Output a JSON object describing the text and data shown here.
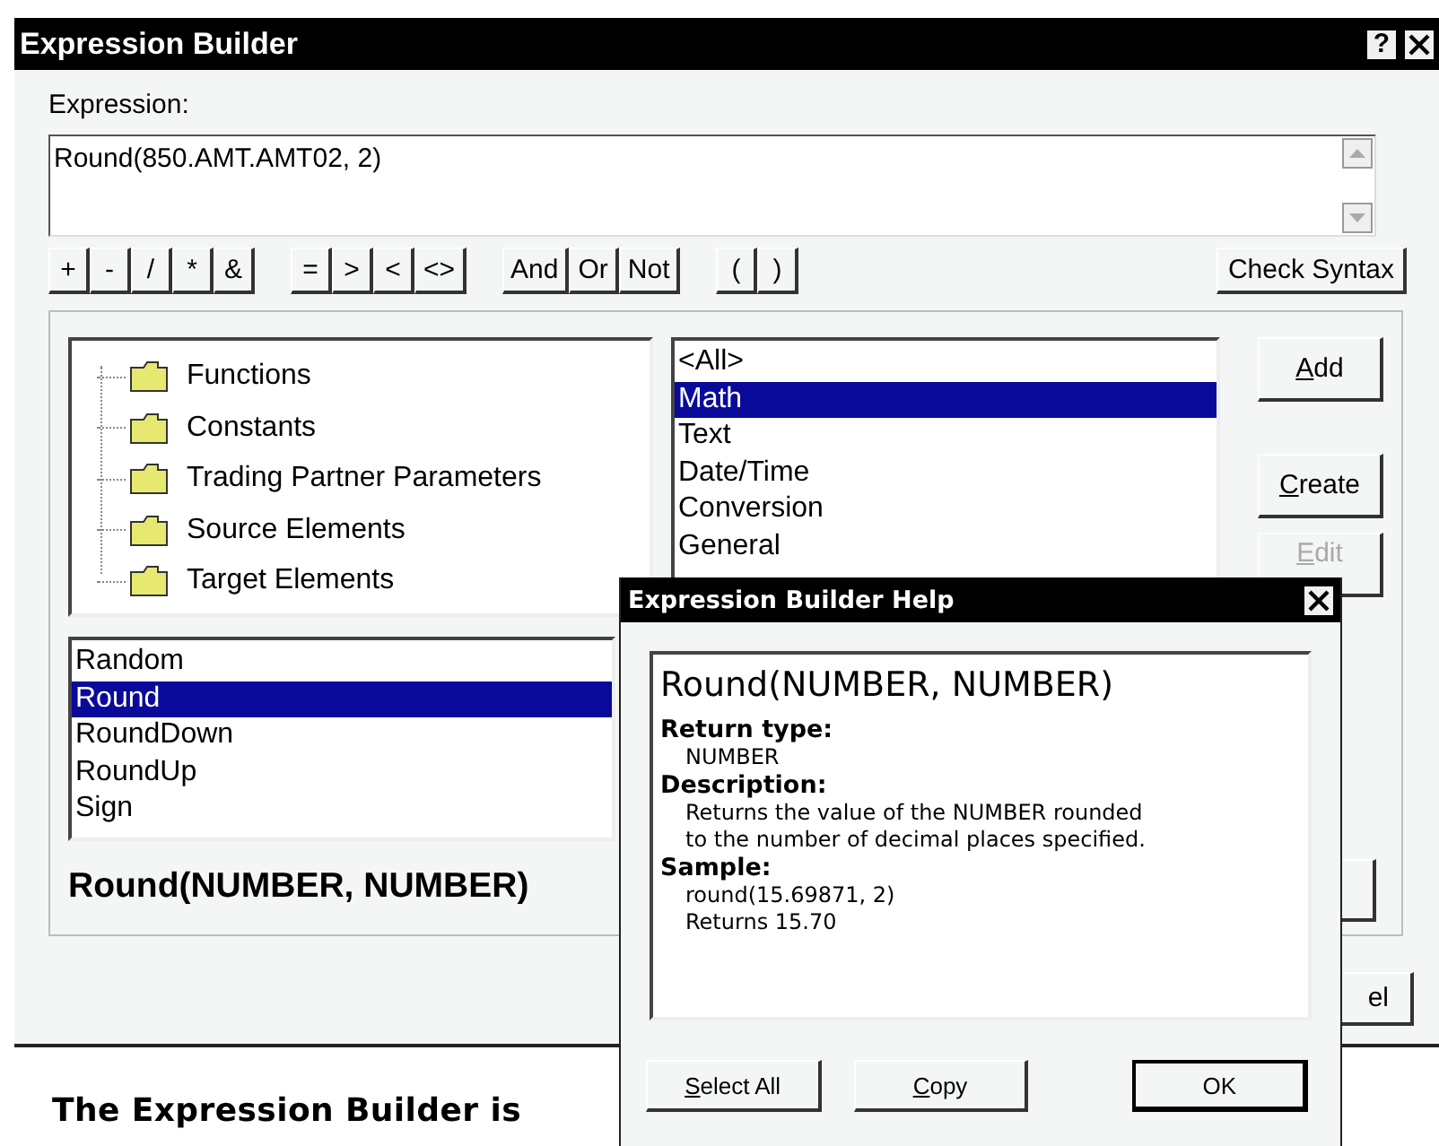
{
  "main_window": {
    "title": "Expression Builder",
    "help_glyph": "?"
  },
  "expression": {
    "label": "Expression:",
    "value": "Round(850.AMT.AMT02, 2)"
  },
  "operator_groups": [
    [
      "+",
      "-",
      "/",
      "*",
      "&"
    ],
    [
      "=",
      ">",
      "<",
      "<>"
    ],
    [
      "And",
      "Or",
      "Not"
    ],
    [
      "(",
      ")"
    ]
  ],
  "check_syntax": "Check Syntax",
  "tree": [
    {
      "label": "Functions"
    },
    {
      "label": "Constants"
    },
    {
      "label": "Trading Partner Parameters"
    },
    {
      "label": "Source Elements"
    },
    {
      "label": "Target Elements"
    }
  ],
  "categories": [
    {
      "label": "<All>",
      "selected": false
    },
    {
      "label": "Math",
      "selected": true
    },
    {
      "label": "Text",
      "selected": false
    },
    {
      "label": "Date/Time",
      "selected": false
    },
    {
      "label": "Conversion",
      "selected": false
    },
    {
      "label": "General",
      "selected": false
    }
  ],
  "side_buttons": [
    {
      "label": "Add",
      "disabled": false
    },
    {
      "label": "Create",
      "disabled": false
    },
    {
      "label": "Edit",
      "disabled": true
    }
  ],
  "functions": [
    {
      "label": "Random",
      "selected": false
    },
    {
      "label": "Round",
      "selected": true
    },
    {
      "label": "RoundDown",
      "selected": false
    },
    {
      "label": "RoundUp",
      "selected": false
    },
    {
      "label": "Sign",
      "selected": false
    }
  ],
  "signature": "Round(NUMBER, NUMBER)",
  "cancel_fragment": "el",
  "help": {
    "title": "Expression Builder Help",
    "heading": "Round(NUMBER, NUMBER)",
    "sections": [
      {
        "label": "Return type:",
        "lines": [
          "NUMBER"
        ]
      },
      {
        "label": "Description:",
        "lines": [
          "Returns the value of the NUMBER rounded",
          "to the number of decimal places specified."
        ]
      },
      {
        "label": "Sample:",
        "lines": [
          "round(15.69871, 2)",
          "Returns 15.70"
        ]
      }
    ],
    "buttons": [
      {
        "label": "Select All",
        "default": false
      },
      {
        "label": "Copy",
        "default": false
      },
      {
        "label": "OK",
        "default": true
      }
    ]
  },
  "caption": "The Expression Builder is"
}
